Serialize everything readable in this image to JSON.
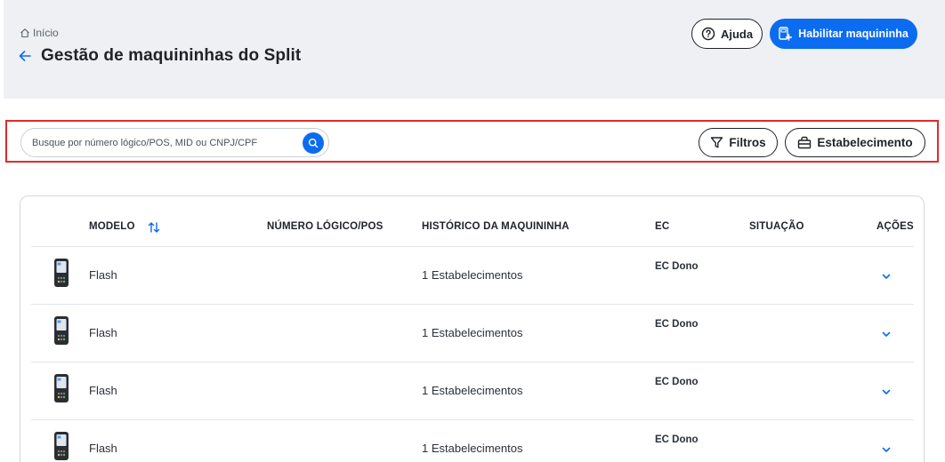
{
  "breadcrumb": {
    "home_label": "Início"
  },
  "page": {
    "title": "Gestão de maquininhas do Split"
  },
  "header_actions": {
    "help_label": "Ajuda",
    "enable_label": "Habilitar maquininha"
  },
  "search": {
    "placeholder": "Busque por número lógico/POS, MID ou CNPJ/CPF",
    "value": ""
  },
  "filters": {
    "filtros_label": "Filtros",
    "estabelecimento_label": "Estabelecimento"
  },
  "table": {
    "headers": {
      "modelo": "MODELO",
      "numero_logico": "NÚMERO LÓGICO/POS",
      "historico": "HISTÓRICO DA MAQUININHA",
      "ec": "EC",
      "situacao": "SITUAÇÃO",
      "acoes": "AÇÕES"
    },
    "rows": [
      {
        "model": "Flash",
        "numero_logico": "",
        "history": "1 Estabelecimentos",
        "ec": "EC Dono",
        "situacao": ""
      },
      {
        "model": "Flash",
        "numero_logico": "",
        "history": "1 Estabelecimentos",
        "ec": "EC Dono",
        "situacao": ""
      },
      {
        "model": "Flash",
        "numero_logico": "",
        "history": "1 Estabelecimentos",
        "ec": "EC Dono",
        "situacao": ""
      },
      {
        "model": "Flash",
        "numero_logico": "",
        "history": "1 Estabelecimentos",
        "ec": "EC Dono",
        "situacao": ""
      }
    ]
  },
  "colors": {
    "primary": "#0b6cf1",
    "header_bg": "#eef0f3",
    "highlight_border": "#e02a2a",
    "text": "#1f2329"
  },
  "icons": [
    "home-icon",
    "arrow-left-icon",
    "help-circle-icon",
    "pos-add-icon",
    "search-icon",
    "filter-icon",
    "store-icon",
    "sort-icon",
    "pos-device-icon",
    "chevron-down-icon"
  ]
}
